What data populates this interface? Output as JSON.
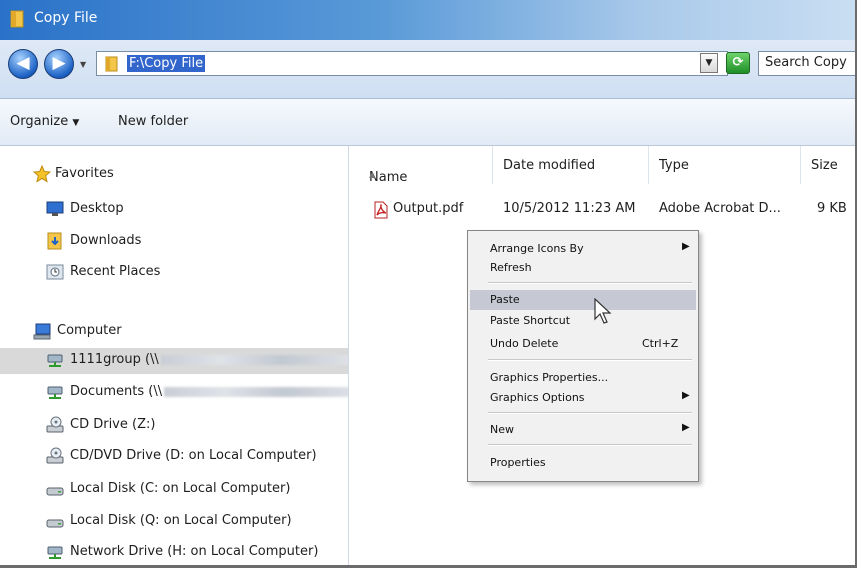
{
  "window": {
    "title": "Copy File"
  },
  "address": {
    "path": "F:\\Copy File",
    "search_text": "Search Copy"
  },
  "toolbar": {
    "organize": "Organize",
    "new_folder": "New folder"
  },
  "nav": {
    "favorites_header": "Favorites",
    "favorites": [
      "Desktop",
      "Downloads",
      "Recent Places"
    ],
    "computer_header": "Computer",
    "drives": [
      {
        "label": "1111group (\\\\",
        "icon": "network-drive-icon",
        "selected": true
      },
      {
        "label": "Documents (\\\\",
        "icon": "network-drive-icon"
      },
      {
        "label": "CD Drive (Z:)",
        "icon": "cd-drive-icon"
      },
      {
        "label": "CD/DVD Drive (D: on Local Computer)",
        "icon": "cd-drive-icon"
      },
      {
        "label": "Local Disk (C: on Local Computer)",
        "icon": "local-disk-icon"
      },
      {
        "label": "Local Disk (Q: on Local Computer)",
        "icon": "local-disk-icon"
      },
      {
        "label": "Network Drive (H: on Local Computer)",
        "icon": "network-drive-icon"
      }
    ]
  },
  "columns": {
    "name": "Name",
    "date": "Date modified",
    "type": "Type",
    "size": "Size"
  },
  "files": [
    {
      "name": "Output.pdf",
      "date": "10/5/2012 11:23 AM",
      "type": "Adobe Acrobat D...",
      "size": "9 KB",
      "icon": "pdf-file-icon"
    }
  ],
  "context_menu": {
    "arrange_icons_by": "Arrange Icons By",
    "refresh": "Refresh",
    "paste": "Paste",
    "paste_shortcut": "Paste Shortcut",
    "undo_delete": "Undo Delete",
    "undo_shortcut": "Ctrl+Z",
    "graphics_properties": "Graphics Properties...",
    "graphics_options": "Graphics Options",
    "new": "New",
    "properties": "Properties"
  },
  "colors": {
    "title_bar": "#2a72c9",
    "selection": "#3266cc",
    "menu_highlight": "#c6c9d3"
  }
}
